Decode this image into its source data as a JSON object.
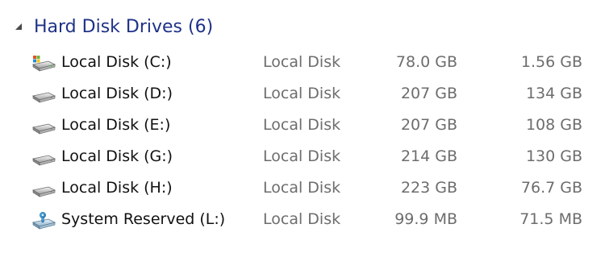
{
  "group": {
    "title": "Hard Disk Drives (6)"
  },
  "drives": [
    {
      "name": "Local Disk (C:)",
      "type": "Local Disk",
      "total": "78.0 GB",
      "free": "1.56 GB",
      "icon": "system-drive-icon"
    },
    {
      "name": "Local Disk (D:)",
      "type": "Local Disk",
      "total": "207 GB",
      "free": "134 GB",
      "icon": "hard-drive-icon"
    },
    {
      "name": "Local Disk (E:)",
      "type": "Local Disk",
      "total": "207 GB",
      "free": "108 GB",
      "icon": "hard-drive-icon"
    },
    {
      "name": "Local Disk (G:)",
      "type": "Local Disk",
      "total": "214 GB",
      "free": "130 GB",
      "icon": "hard-drive-icon"
    },
    {
      "name": "Local Disk (H:)",
      "type": "Local Disk",
      "total": "223 GB",
      "free": "76.7 GB",
      "icon": "hard-drive-icon"
    },
    {
      "name": "System Reserved (L:)",
      "type": "Local Disk",
      "total": "99.9 MB",
      "free": "71.5 MB",
      "icon": "system-reserved-drive-icon"
    }
  ],
  "colors": {
    "group_title": "#1e3287",
    "primary_text": "#111111",
    "secondary_text": "#6d6d6d"
  }
}
